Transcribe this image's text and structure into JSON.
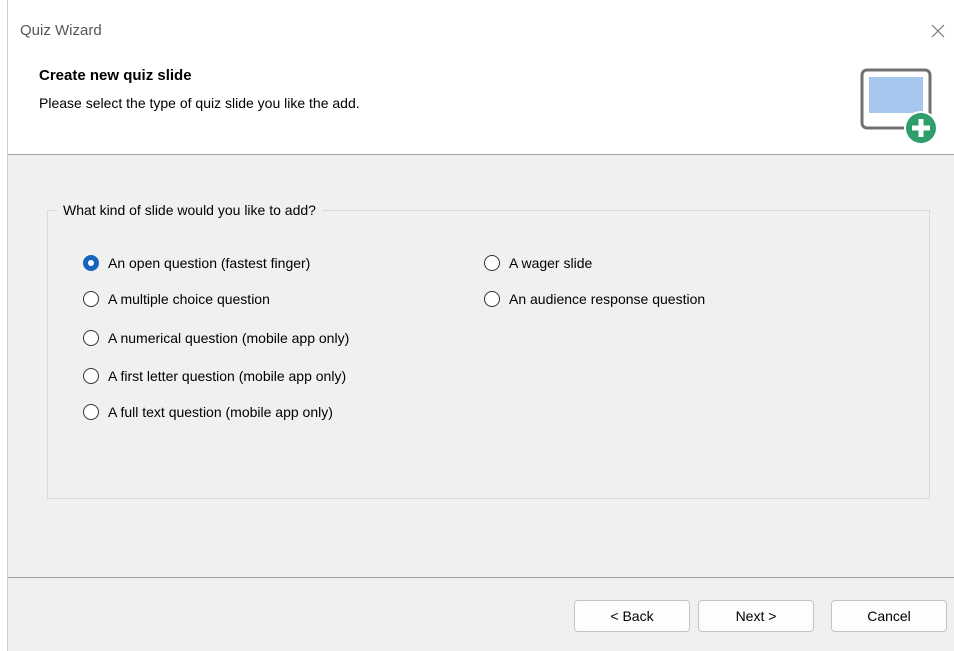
{
  "window": {
    "title": "Quiz Wizard",
    "close_icon": "close-icon"
  },
  "header": {
    "title": "Create new quiz slide",
    "subtitle": "Please select the type of quiz slide you like the add.",
    "icon": "add-slide-icon"
  },
  "group": {
    "legend": "What kind of slide would you like to add?",
    "options_left": [
      {
        "label": "An open question (fastest finger)",
        "checked": true
      },
      {
        "label": "A multiple choice question",
        "checked": false
      },
      {
        "label": "A numerical question (mobile app only)",
        "checked": false
      },
      {
        "label": "A first letter question (mobile app only)",
        "checked": false
      },
      {
        "label": "A full text question (mobile app only)",
        "checked": false
      }
    ],
    "options_right": [
      {
        "label": "A wager slide",
        "checked": false
      },
      {
        "label": "An audience response question",
        "checked": false
      }
    ]
  },
  "footer": {
    "back_label": "< Back",
    "next_label": "Next >",
    "cancel_label": "Cancel"
  },
  "colors": {
    "accent": "#1565c0",
    "dialog_bg": "#f0f0f0",
    "plus_badge": "#2e9e6a"
  }
}
